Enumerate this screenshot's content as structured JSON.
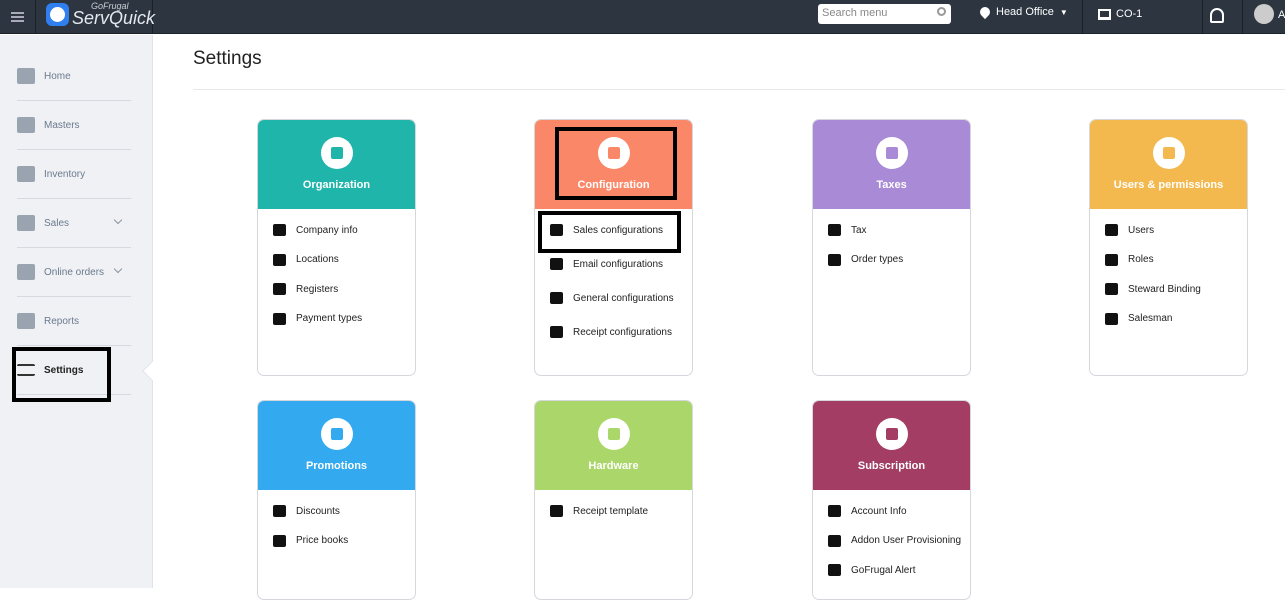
{
  "topbar": {
    "brand_small": "GoFrugal",
    "brand": "ServQuick",
    "search_placeholder": "Search menu",
    "location": "Head Office",
    "register": "CO-1",
    "user_initial": "A"
  },
  "sidebar": {
    "items": [
      {
        "label": "Home"
      },
      {
        "label": "Masters"
      },
      {
        "label": "Inventory"
      },
      {
        "label": "Sales",
        "expandable": true
      },
      {
        "label": "Online orders",
        "expandable": true
      },
      {
        "label": "Reports"
      },
      {
        "label": "Settings",
        "active": true
      }
    ]
  },
  "page": {
    "title": "Settings"
  },
  "cards": [
    {
      "title": "Organization",
      "color": "#20b5aa",
      "icon": "bank-icon",
      "items": [
        {
          "label": "Company info",
          "icon": "buildings-icon"
        },
        {
          "label": "Locations",
          "icon": "map-pin-icon"
        },
        {
          "label": "Registers",
          "icon": "laptop-icon"
        },
        {
          "label": "Payment types",
          "icon": "money-icon"
        }
      ]
    },
    {
      "title": "Configuration",
      "color": "#fa8767",
      "icon": "gears-icon",
      "items": [
        {
          "label": "Sales configurations",
          "icon": "cart-icon"
        },
        {
          "label": "Email configurations",
          "icon": "envelope-icon"
        },
        {
          "label": "General configurations",
          "icon": "gear-icon"
        },
        {
          "label": "Receipt configurations",
          "icon": "list-icon"
        }
      ]
    },
    {
      "title": "Taxes",
      "color": "#a88ad6",
      "icon": "calculator-icon",
      "items": [
        {
          "label": "Tax",
          "icon": "calculator-icon"
        },
        {
          "label": "Order types",
          "icon": "food-tray-icon"
        }
      ]
    },
    {
      "title": "Users & permissions",
      "color": "#f4b94e",
      "icon": "users-icon",
      "items": [
        {
          "label": "Users",
          "icon": "user-icon"
        },
        {
          "label": "Roles",
          "icon": "key-icon"
        },
        {
          "label": "Steward Binding",
          "icon": "steward-icon"
        },
        {
          "label": "Salesman",
          "icon": "tag-icon"
        }
      ]
    },
    {
      "title": "Promotions",
      "color": "#33aaf0",
      "icon": "gift-icon",
      "items": [
        {
          "label": "Discounts",
          "icon": "percent-icon"
        },
        {
          "label": "Price books",
          "icon": "price-book-icon"
        }
      ]
    },
    {
      "title": "Hardware",
      "color": "#aad66a",
      "icon": "printer-icon",
      "items": [
        {
          "label": "Receipt template",
          "icon": "receipt-icon"
        }
      ]
    },
    {
      "title": "Subscription",
      "color": "#a33d64",
      "icon": "money-icon",
      "items": [
        {
          "label": "Account Info",
          "icon": "id-card-icon"
        },
        {
          "label": "Addon User Provisioning",
          "icon": "user-add-icon"
        },
        {
          "label": "GoFrugal Alert",
          "icon": "envelope-icon"
        }
      ]
    }
  ]
}
